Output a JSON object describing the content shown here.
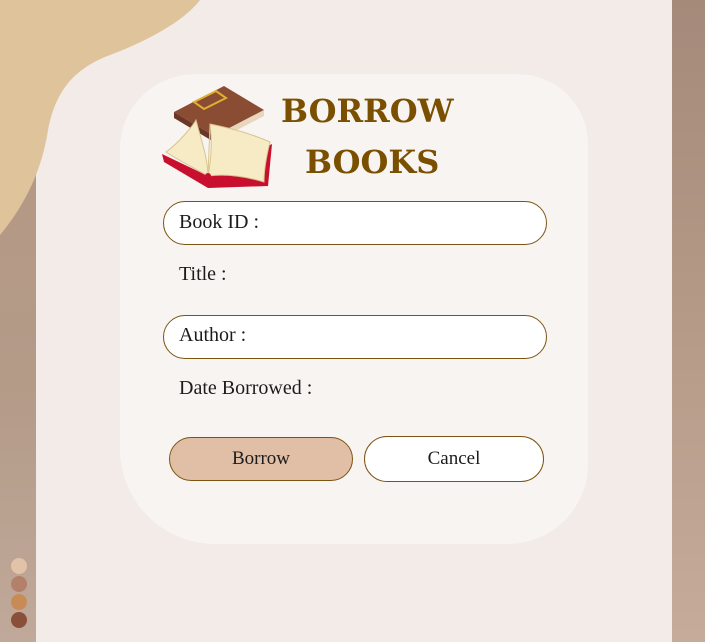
{
  "header": {
    "title_line1": "BORROW",
    "title_line2": "BOOKS"
  },
  "form": {
    "book_id_label": "Book ID :",
    "title_label": "Title :",
    "author_label": "Author :",
    "date_borrowed_label": "Date Borrowed :"
  },
  "buttons": {
    "borrow_label": "Borrow",
    "cancel_label": "Cancel"
  },
  "palette": {
    "colors": [
      "#e2c3a8",
      "#b3806a",
      "#c98b55",
      "#8a4f38"
    ],
    "title_color": "#7a5000",
    "accent_fill": "#e0bfa6",
    "border": "#7a5512"
  },
  "icons": {
    "logo": "books-icon"
  }
}
